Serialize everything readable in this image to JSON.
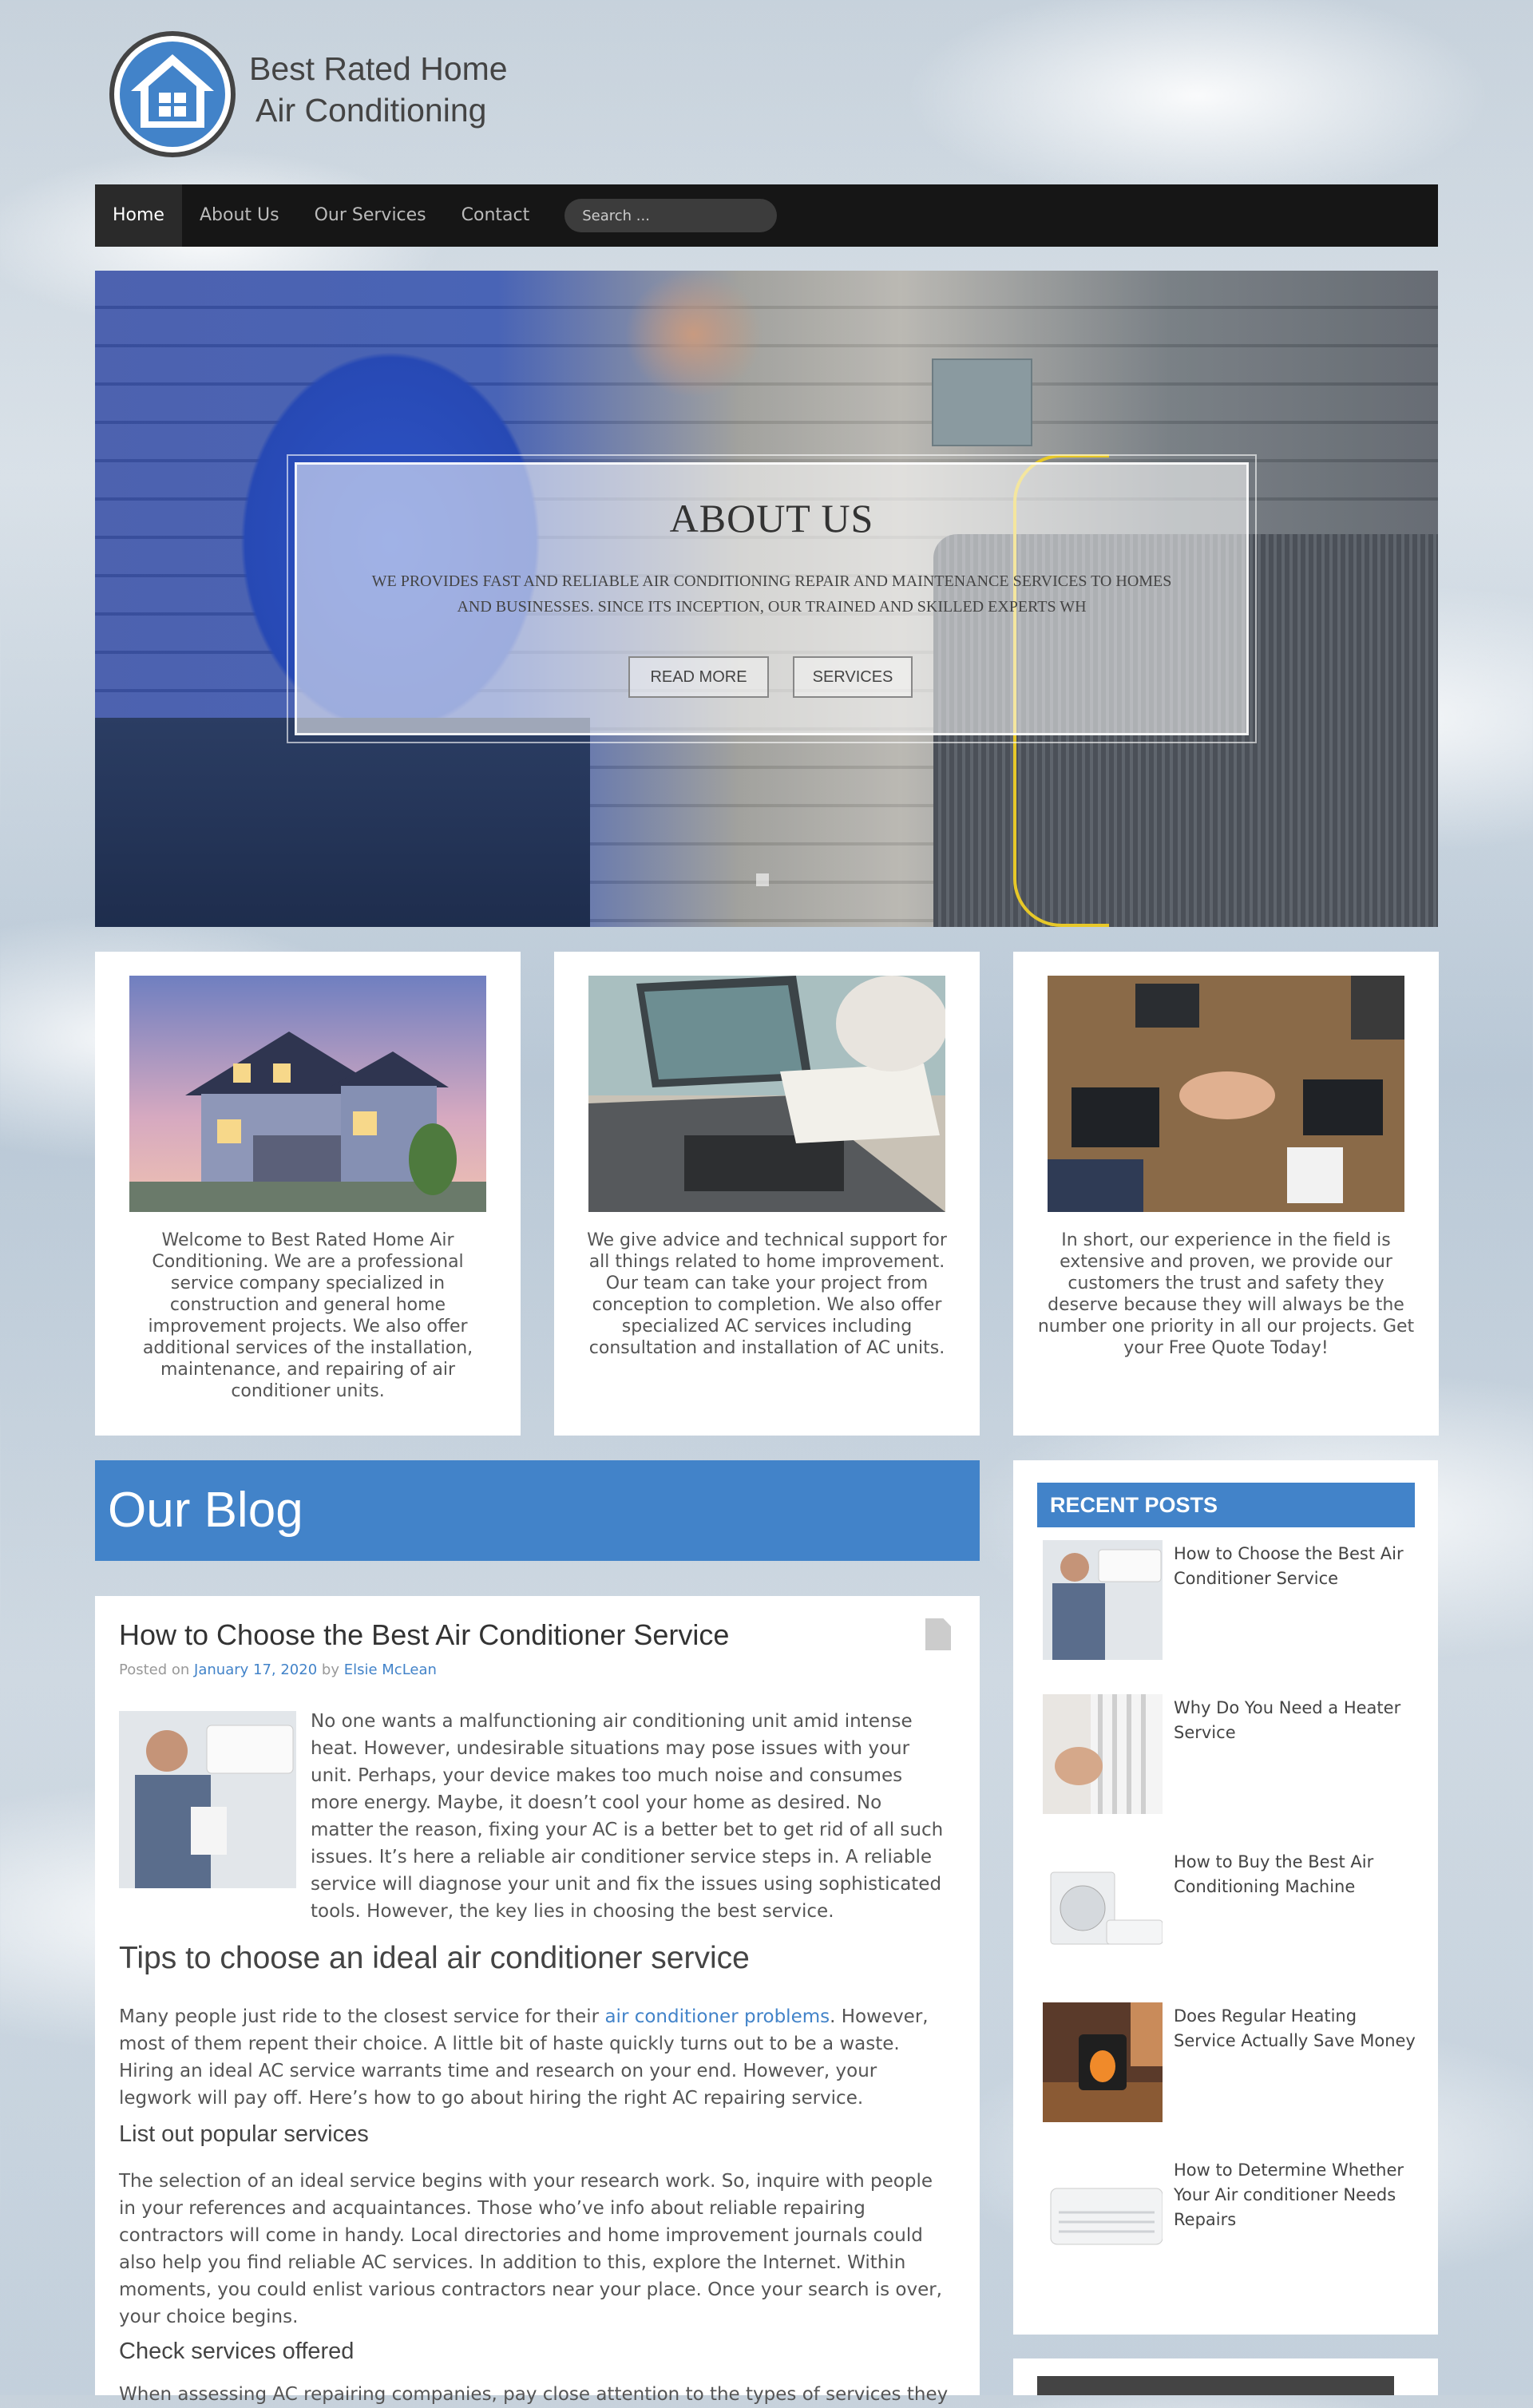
{
  "site": {
    "name_line1": "Best Rated Home",
    "name_line2": "Air Conditioning"
  },
  "nav": {
    "items": [
      {
        "label": "Home",
        "active": true
      },
      {
        "label": "About Us",
        "active": false
      },
      {
        "label": "Our Services",
        "active": false
      },
      {
        "label": "Contact",
        "active": false
      }
    ],
    "search_placeholder": "Search ..."
  },
  "hero": {
    "title": "ABOUT US",
    "text": "WE PROVIDES FAST AND RELIABLE AIR CONDITIONING REPAIR AND MAINTENANCE SERVICES TO HOMES AND BUSINESSES. SINCE ITS INCEPTION, OUR TRAINED AND SKILLED EXPERTS WH",
    "buttons": [
      "READ MORE",
      "SERVICES"
    ]
  },
  "features": [
    {
      "text": "Welcome to Best Rated Home Air Conditioning. We are a professional service company specialized in construction and general home improvement projects. We also offer additional services of the installation, maintenance, and repairing of air conditioner units."
    },
    {
      "text": "We give advice and technical support for all things related to home improvement. Our team can take your project from conception to completion. We also offer specialized AC services including consultation and installation of AC units."
    },
    {
      "text": "In short, our experience in the field is extensive and proven, we provide our customers the trust and safety they deserve because they will always be the number one priority in all our projects. Get your Free Quote Today!"
    }
  ],
  "blog": {
    "heading": "Our Blog",
    "post": {
      "title": "How to Choose the Best Air Conditioner Service",
      "posted_on": "Posted on",
      "date": "January 17, 2020",
      "by": "by",
      "author": "Elsie McLean",
      "intro": "No one wants a malfunctioning air conditioning unit amid intense heat. However, undesirable situations may pose issues with your unit. Perhaps, your device makes too much noise and consumes more energy. Maybe, it doesn’t cool your home as desired. No matter the reason, fixing your AC is a better bet to get rid of all such issues. It’s here a reliable air conditioner service steps in. A reliable service will diagnose your unit and fix the issues using sophisticated tools. However, the key lies in choosing the best service.",
      "h2": "Tips to choose an ideal air conditioner service",
      "p2_before": "Many people just ride to the closest service for their ",
      "p2_link": "air conditioner problems",
      "p2_after": ". However, most of them repent their choice. A little bit of haste quickly turns out to be a waste. Hiring an ideal AC service warrants time and research on your end. However, your legwork will pay off. Here’s how to go about hiring the right AC repairing service.",
      "h3a": "List out popular services",
      "p3": "The selection of an ideal service begins with your research work. So, inquire with people in your references and acquaintances. Those who’ve info about reliable repairing contractors will come in handy. Local directories and home improvement journals could also help you find reliable AC services. In addition to this, explore the Internet. Within moments, you could enlist various contractors near your place. Once your search is over, your choice begins.",
      "h3b": "Check services offered",
      "p4": "When assessing AC repairing companies, pay close attention to the types of services they"
    }
  },
  "sidebar": {
    "heading": "RECENT POSTS",
    "posts": [
      "How to Choose the Best Air Conditioner Service",
      "Why Do You Need a Heater Service",
      "How to Buy the Best Air Conditioning Machine",
      "Does Regular Heating Service Actually Save Money",
      "How to Determine Whether Your Air conditioner Needs Repairs"
    ]
  },
  "colors": {
    "accent": "#4283c9",
    "nav_bg": "#161616"
  }
}
